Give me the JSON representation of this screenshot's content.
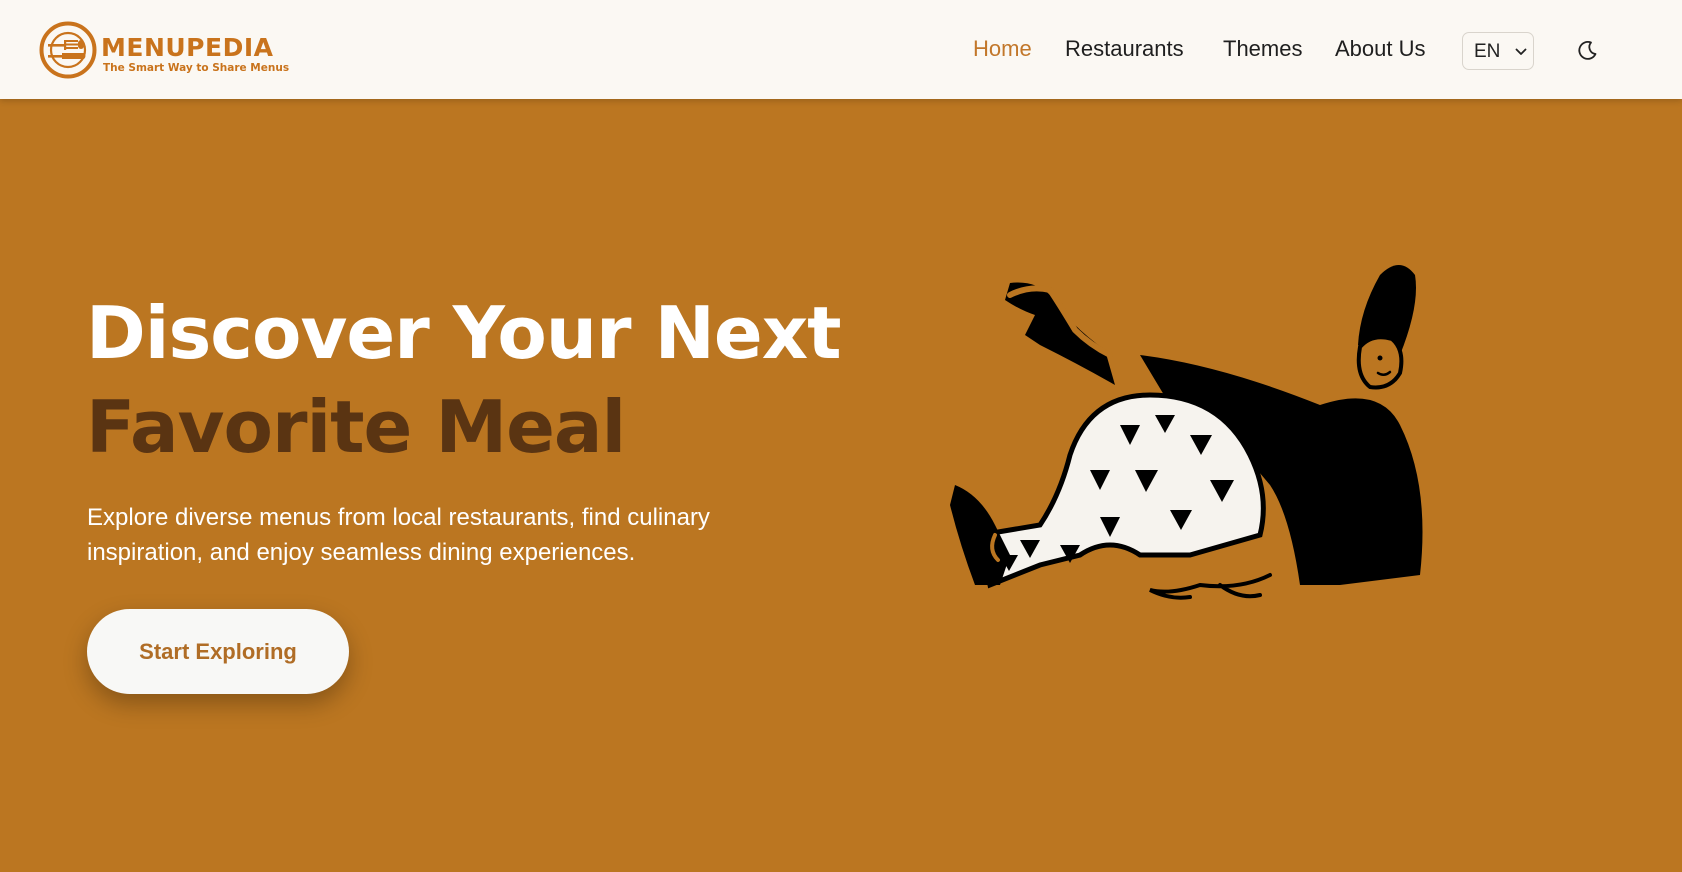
{
  "brand": {
    "name": "MENUPEDIA",
    "tagline": "The Smart Way to Share Menus",
    "logo_icon": "plate-fork-knife-icon",
    "color": "#c9731c"
  },
  "nav": {
    "items": [
      {
        "label": "Home",
        "active": true
      },
      {
        "label": "Restaurants",
        "active": false
      },
      {
        "label": "Themes",
        "active": false
      },
      {
        "label": "About Us",
        "active": false
      }
    ],
    "language": {
      "selected": "EN",
      "icon": "chevron-down-icon"
    },
    "theme_toggle_icon": "moon-icon"
  },
  "hero": {
    "title_line1": "Discover Your Next",
    "title_line2": "Favorite Meal",
    "subtitle": "Explore diverse menus from local restaurants, find culinary inspiration, and enjoy seamless dining experiences.",
    "cta_label": "Start Exploring",
    "illustration": "reclining-person-illustration"
  },
  "colors": {
    "hero_background": "#bb7621",
    "navbar_background": "#fbf8f3",
    "accent": "#c2772a",
    "title_dark": "#5a3412"
  }
}
